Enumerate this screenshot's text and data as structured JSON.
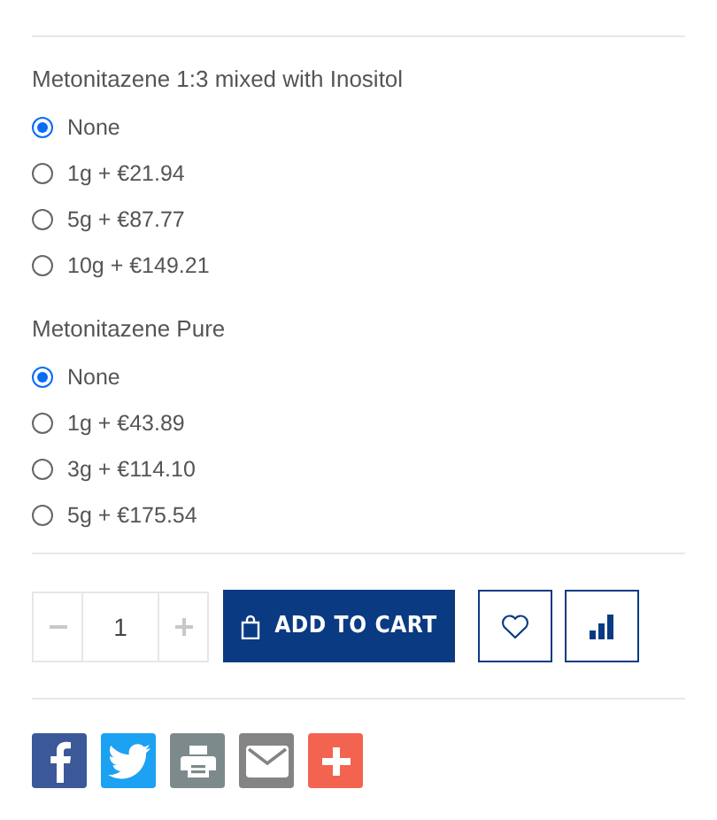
{
  "option_groups": [
    {
      "title": "Metonitazene 1:3 mixed with Inositol",
      "options": [
        {
          "label": "None",
          "selected": true
        },
        {
          "label": "1g + €21.94",
          "selected": false
        },
        {
          "label": "5g + €87.77",
          "selected": false
        },
        {
          "label": "10g + €149.21",
          "selected": false
        }
      ]
    },
    {
      "title": "Metonitazene Pure",
      "options": [
        {
          "label": "None",
          "selected": true
        },
        {
          "label": "1g + €43.89",
          "selected": false
        },
        {
          "label": "3g + €114.10",
          "selected": false
        },
        {
          "label": "5g + €175.54",
          "selected": false
        }
      ]
    }
  ],
  "quantity": {
    "value": "1"
  },
  "add_to_cart": {
    "label": "ADD TO CART"
  },
  "share_buttons": [
    {
      "kind": "facebook",
      "color": "#3b5998"
    },
    {
      "kind": "twitter",
      "color": "#1da1f2"
    },
    {
      "kind": "print",
      "color": "#7c8a8b"
    },
    {
      "kind": "email",
      "color": "#848484"
    },
    {
      "kind": "more",
      "color": "#f26450"
    }
  ]
}
